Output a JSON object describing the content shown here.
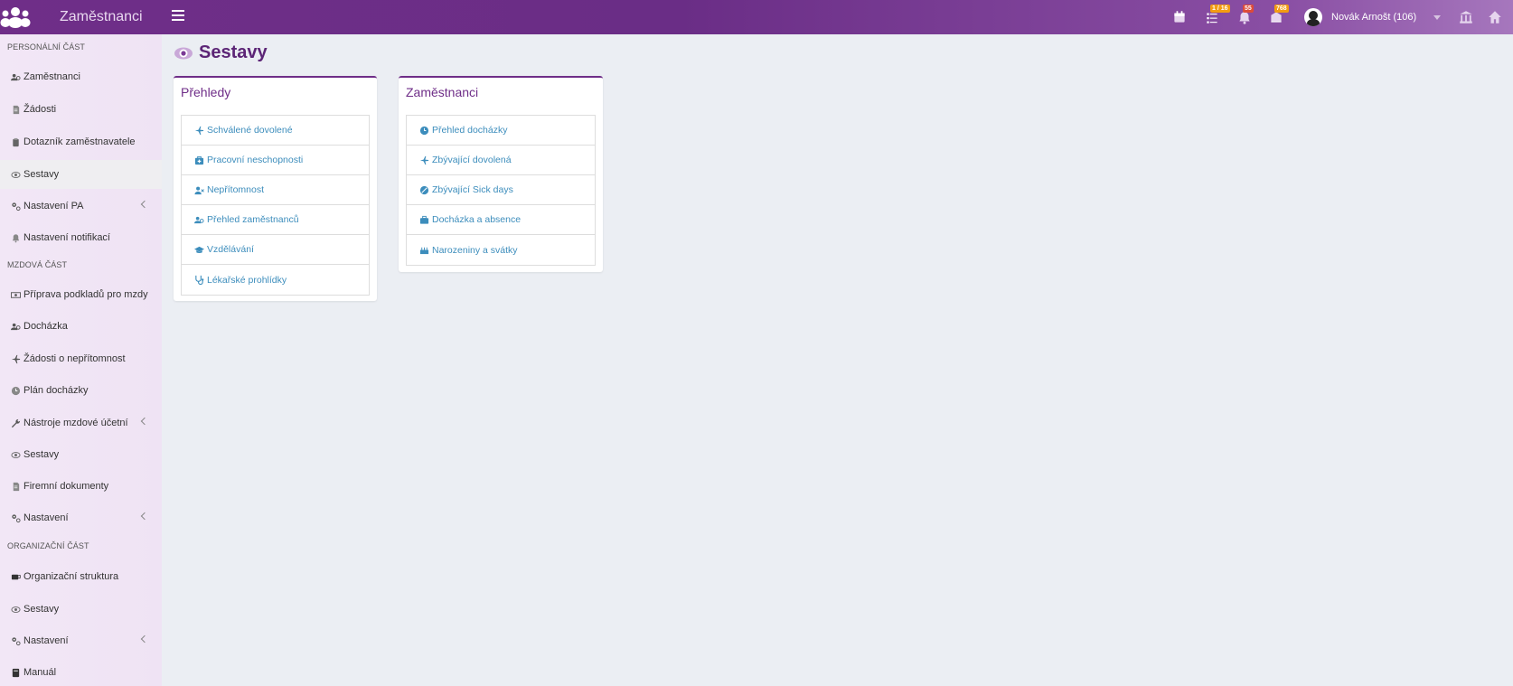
{
  "app": {
    "title": "Zaměstnanci"
  },
  "header": {
    "badges": {
      "tasks": "1 / 16",
      "bell": "55",
      "notifications": "768"
    },
    "user_name": "Novák Arnošt (106)"
  },
  "sidebar": {
    "section_personal": "PERSONÁLNÍ ČÁST",
    "section_payroll": "MZDOVÁ ČÁST",
    "section_org": "ORGANIZAČNÍ ČÁST",
    "items": [
      {
        "label": "Zaměstnanci"
      },
      {
        "label": "Žádosti"
      },
      {
        "label": "Dotazník zaměstnavatele"
      },
      {
        "label": "Sestavy"
      },
      {
        "label": "Nastavení PA"
      },
      {
        "label": "Nastavení notifikací"
      },
      {
        "label": "Příprava podkladů pro mzdy"
      },
      {
        "label": "Docházka"
      },
      {
        "label": "Žádosti o nepřítomnost"
      },
      {
        "label": "Plán docházky"
      },
      {
        "label": "Nástroje mzdové účetní"
      },
      {
        "label": "Sestavy"
      },
      {
        "label": "Firemní dokumenty"
      },
      {
        "label": "Nastavení"
      },
      {
        "label": "Organizační struktura"
      },
      {
        "label": "Sestavy"
      },
      {
        "label": "Nastavení"
      },
      {
        "label": "Manuál"
      }
    ]
  },
  "main": {
    "title": "Sestavy",
    "cards": [
      {
        "title": "Přehledy",
        "items": [
          {
            "label": "Schválené dovolené"
          },
          {
            "label": "Pracovní neschopnosti"
          },
          {
            "label": "Nepřítomnost"
          },
          {
            "label": "Přehled zaměstnanců"
          },
          {
            "label": "Vzdělávání"
          },
          {
            "label": "Lékařské prohlídky"
          }
        ]
      },
      {
        "title": "Zaměstnanci",
        "items": [
          {
            "label": "Přehled docházky"
          },
          {
            "label": "Zbývající dovolená"
          },
          {
            "label": "Zbývající Sick days"
          },
          {
            "label": "Docházka a absence"
          },
          {
            "label": "Narozeniny a svátky"
          }
        ]
      }
    ]
  },
  "colors": {
    "brand": "#6f2e88",
    "link": "#3c8dbc",
    "badge_orange": "#f39c12",
    "badge_red": "#dd4b39"
  }
}
